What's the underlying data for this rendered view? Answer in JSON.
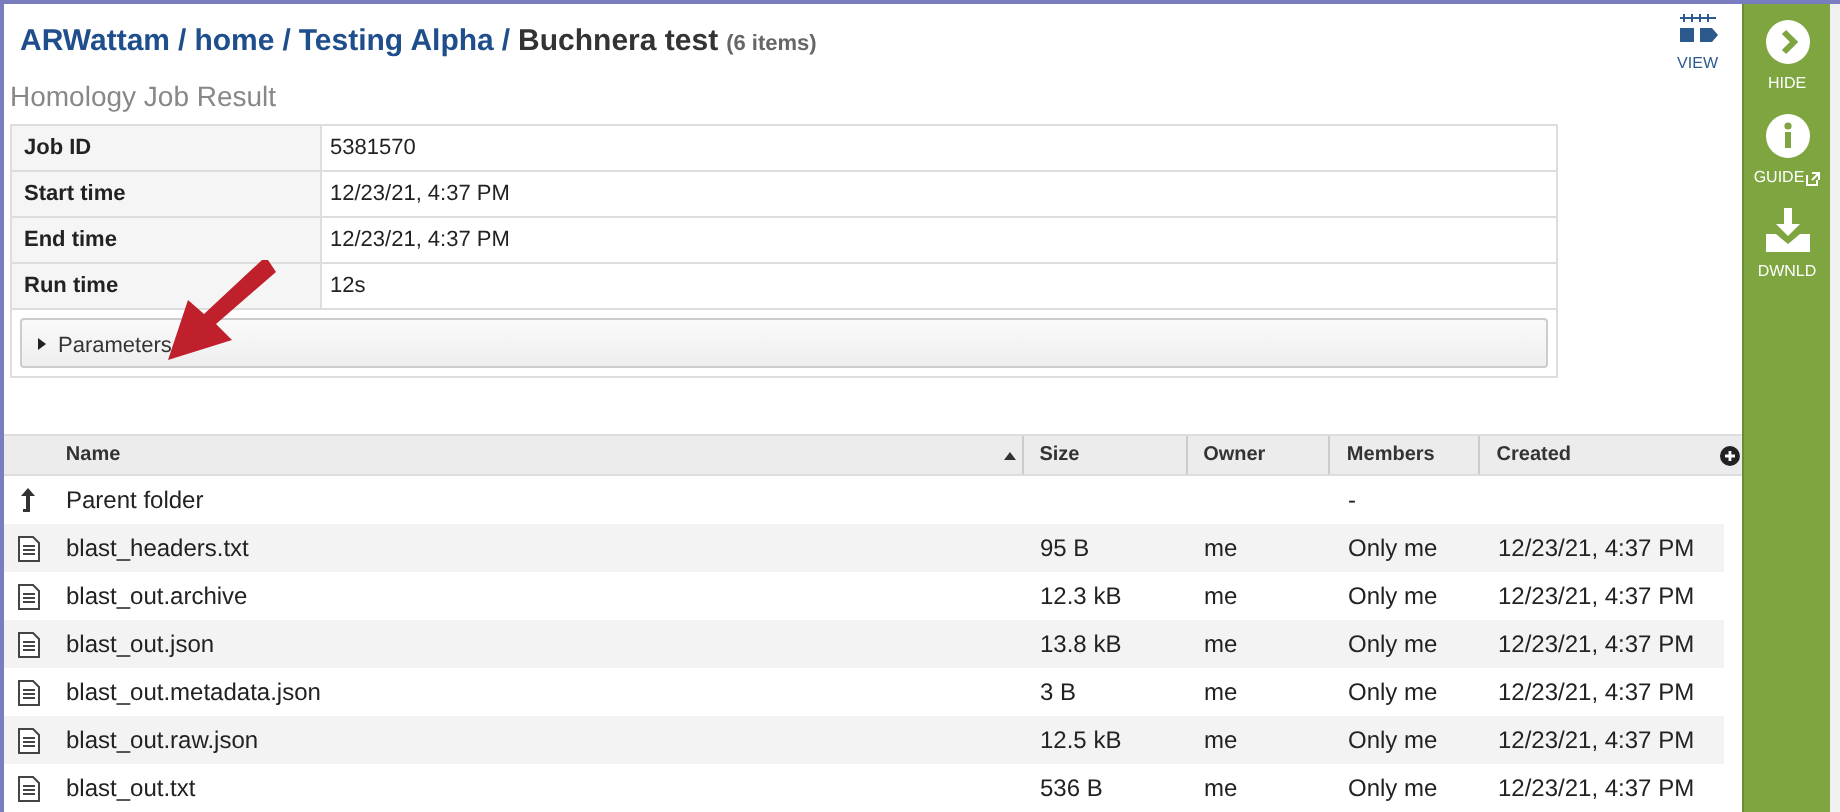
{
  "breadcrumb": {
    "links": [
      "ARWattam",
      "home",
      "Testing Alpha"
    ],
    "separator": "/",
    "current": "Buchnera test",
    "count": "(6 items)"
  },
  "view_button": {
    "label": "VIEW"
  },
  "job": {
    "title": "Homology Job Result",
    "rows": [
      {
        "label": "Job ID",
        "value": "5381570"
      },
      {
        "label": "Start time",
        "value": "12/23/21, 4:37 PM"
      },
      {
        "label": "End time",
        "value": "12/23/21, 4:37 PM"
      },
      {
        "label": "Run time",
        "value": "12s"
      }
    ],
    "parameters": {
      "label": "Parameters",
      "expanded": false
    }
  },
  "table": {
    "columns": [
      {
        "label": "Name",
        "sorted": true
      },
      {
        "label": "Size",
        "sorted": false
      },
      {
        "label": "Owner",
        "sorted": false
      },
      {
        "label": "Members",
        "sorted": false
      },
      {
        "label": "Created",
        "sorted": false
      }
    ],
    "rows": [
      {
        "kind": "parent",
        "cells": [
          "Parent folder",
          "",
          "",
          "-",
          ""
        ]
      },
      {
        "kind": "file",
        "cells": [
          "blast_headers.txt",
          "95 B",
          "me",
          "Only me",
          "12/23/21, 4:37 PM"
        ]
      },
      {
        "kind": "file",
        "cells": [
          "blast_out.archive",
          "12.3 kB",
          "me",
          "Only me",
          "12/23/21, 4:37 PM"
        ]
      },
      {
        "kind": "file",
        "cells": [
          "blast_out.json",
          "13.8 kB",
          "me",
          "Only me",
          "12/23/21, 4:37 PM"
        ]
      },
      {
        "kind": "file",
        "cells": [
          "blast_out.metadata.json",
          "3 B",
          "me",
          "Only me",
          "12/23/21, 4:37 PM"
        ]
      },
      {
        "kind": "file",
        "cells": [
          "blast_out.raw.json",
          "12.5 kB",
          "me",
          "Only me",
          "12/23/21, 4:37 PM"
        ]
      },
      {
        "kind": "file",
        "cells": [
          "blast_out.txt",
          "536 B",
          "me",
          "Only me",
          "12/23/21, 4:37 PM"
        ]
      }
    ]
  },
  "sidebar": {
    "items": [
      {
        "kind": "hide",
        "label": "HIDE"
      },
      {
        "kind": "guide",
        "label": "GUIDE"
      },
      {
        "kind": "download",
        "label": "DWNLD"
      }
    ]
  }
}
